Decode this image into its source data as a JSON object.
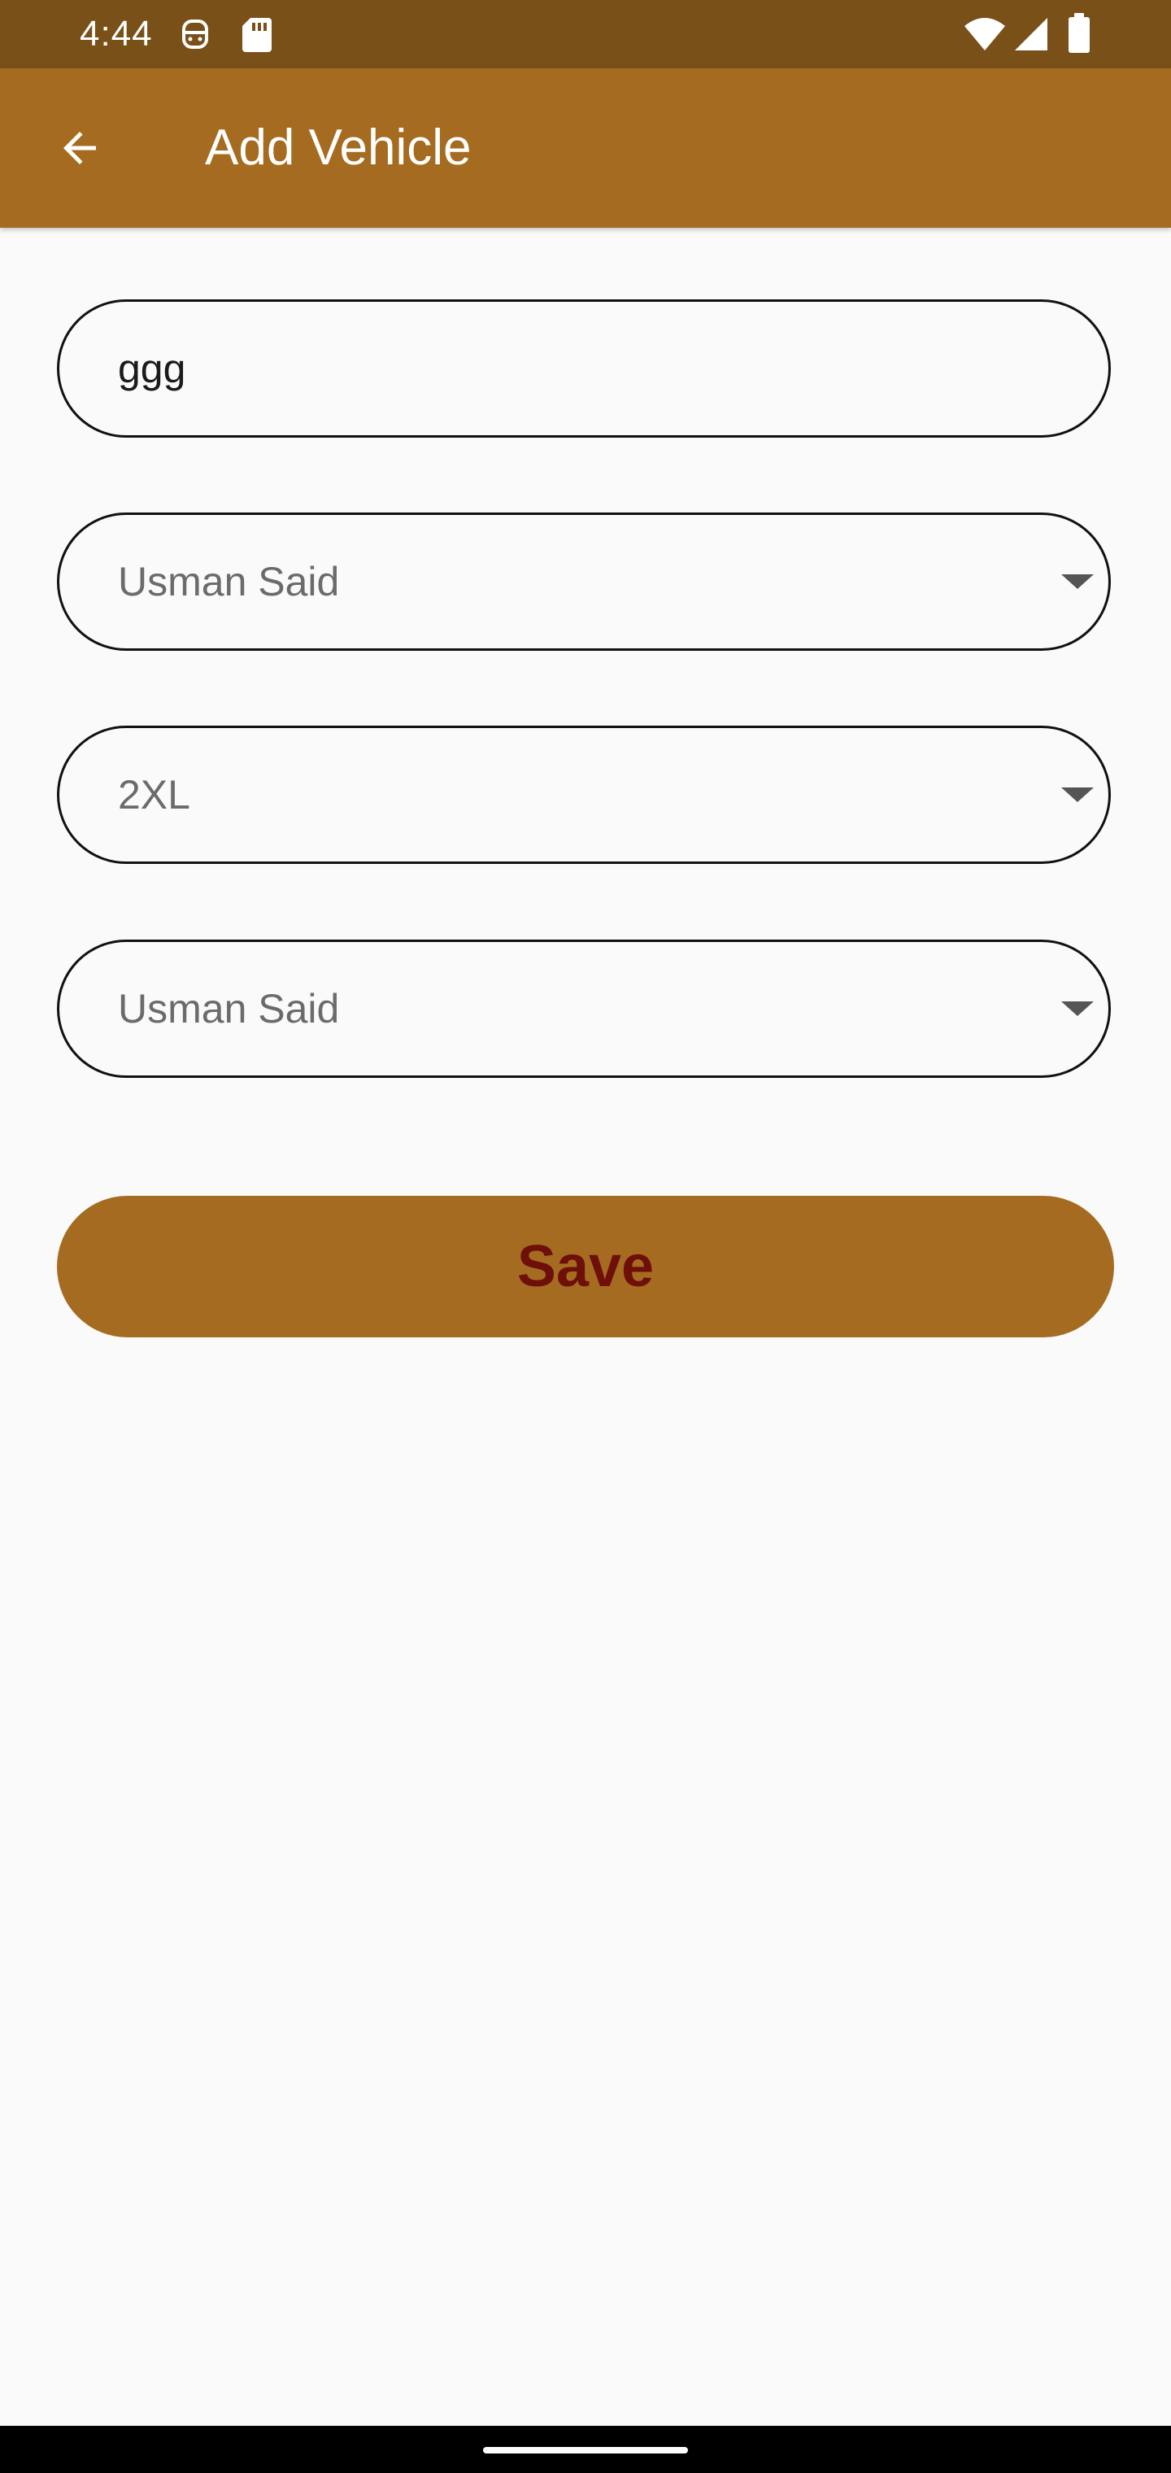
{
  "status_bar": {
    "time": "4:44",
    "icons": [
      "face-notification-icon",
      "sd-card-icon",
      "wifi-icon",
      "cellular-signal-icon",
      "battery-icon"
    ]
  },
  "app_bar": {
    "title": "Add Vehicle",
    "back_icon": "arrow-back-icon",
    "color": "#a56c21",
    "status_color": "#7a5019"
  },
  "form": {
    "vehicle_name_value": "ggg",
    "dropdowns": [
      {
        "selected": "Usman Said",
        "icon": "dropdown-arrow-icon"
      },
      {
        "selected": "2XL",
        "icon": "dropdown-arrow-icon"
      },
      {
        "selected": "Usman Said",
        "icon": "dropdown-arrow-icon"
      }
    ],
    "save_label": "Save",
    "save_text_color": "#6e0f0a"
  }
}
